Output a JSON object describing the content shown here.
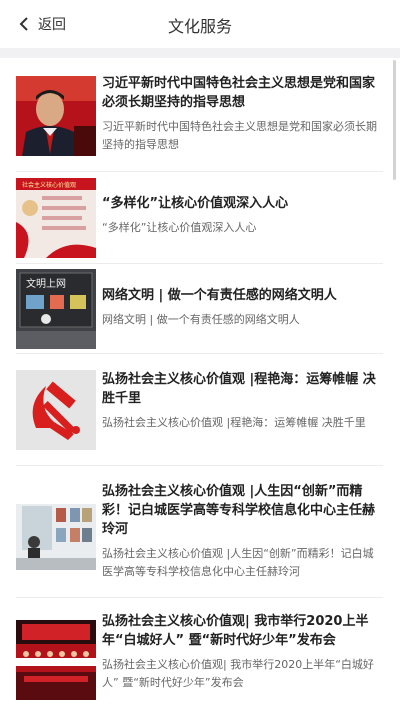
{
  "header": {
    "back_label": "返回",
    "title": "文化服务"
  },
  "articles": [
    {
      "title": "习近平新时代中国特色社会主义思想是党和国家必须长期坚持的指导思想",
      "summary": "习近平新时代中国特色社会主义思想是党和国家必须长期坚持的指导思想"
    },
    {
      "title": "“多样化”让核心价值观深入人心",
      "summary": "“多样化”让核心价值观深入人心"
    },
    {
      "title": "网络文明 | 做一个有责任感的网络文明人",
      "summary": "网络文明 | 做一个有责任感的网络文明人"
    },
    {
      "title": "弘扬社会主义核心价值观 |程艳海：运筹帷幄 决胜千里",
      "summary": "弘扬社会主义核心价值观 |程艳海：运筹帷幄 决胜千里"
    },
    {
      "title": "弘扬社会主义核心价值观 |人生因“创新”而精彩！记白城医学高等专科学校信息化中心主任赫玲河",
      "summary": "弘扬社会主义核心价值观 |人生因“创新”而精彩！记白城医学高等专科学校信息化中心主任赫玲河"
    },
    {
      "title": "弘扬社会主义核心价值观| 我市举行2020上半年“白城好人” 暨“新时代好少年”发布会",
      "summary": "弘扬社会主义核心价值观| 我市举行2020上半年“白城好人” 暨“新时代好少年”发布会"
    }
  ],
  "thumb_texts": {
    "banner": "社会主义核心价值观",
    "board": "文明上网"
  },
  "colors": {
    "accent_red": "#c8141e",
    "separator": "#f1f1f3"
  }
}
